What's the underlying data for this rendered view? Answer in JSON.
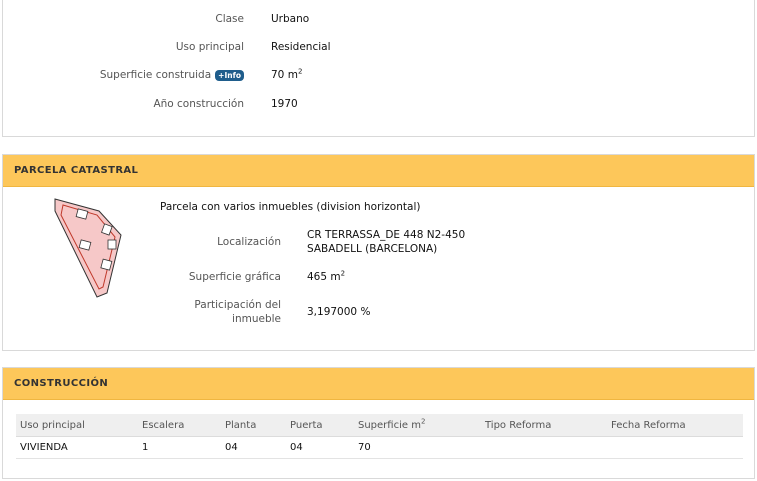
{
  "inmueble": {
    "clase_label": "Clase",
    "clase_value": "Urbano",
    "uso_label": "Uso principal",
    "uso_value": "Residencial",
    "superficie_label": "Superficie construida",
    "info_badge": "+Info",
    "superficie_value": "70 m",
    "superficie_unit_sup": "2",
    "anio_label": "Año construcción",
    "anio_value": "1970"
  },
  "parcela": {
    "header": "PARCELA CATASTRAL",
    "descripcion": "Parcela con varios inmuebles (division horizontal)",
    "localizacion_label": "Localización",
    "localizacion_line1": "CR TERRASSA_DE 448 N2-450",
    "localizacion_line2": "SABADELL (BARCELONA)",
    "superficie_label": "Superficie gráfica",
    "superficie_value": "465 m",
    "superficie_unit_sup": "2",
    "participacion_label_1": "Participación del",
    "participacion_label_2": "inmueble",
    "participacion_value": "3,197000 %"
  },
  "construccion": {
    "header": "CONSTRUCCIÓN",
    "columns": [
      "Uso principal",
      "Escalera",
      "Planta",
      "Puerta",
      "Superficie m",
      "Tipo Reforma",
      "Fecha Reforma"
    ],
    "superficie_col_sup": "2",
    "rows": [
      [
        "VIVIENDA",
        "1",
        "04",
        "04",
        "70",
        "",
        ""
      ]
    ]
  },
  "colors": {
    "header_bg": "#fdc75a",
    "badge_bg": "#1f5d8c",
    "parcel_fill": "#f6c8c8",
    "parcel_stroke": "#c0392b"
  }
}
